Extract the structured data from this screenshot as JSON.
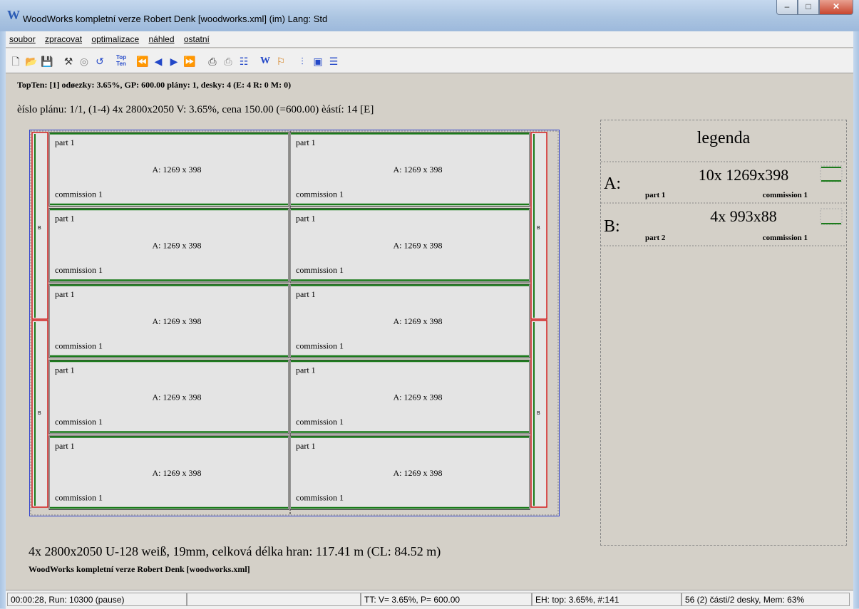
{
  "window": {
    "title": "WoodWorks kompletní verze Robert Denk [woodworks.xml] (im) Lang: Std",
    "icon": "W"
  },
  "menu": [
    "soubor",
    "zpracovat",
    "optimalizace",
    "náhled",
    "ostatní"
  ],
  "info": {
    "line1": "TopTen: [1] odøezky:  3.65%, GP: 600.00 plány: 1, desky: 4 (E: 4 R: 0 M: 0)",
    "line2": "èíslo plánu: 1/1, (1-4) 4x 2800x2050 V:  3.65%, cena 150.00 (=600.00) èástí: 14    [E]"
  },
  "parts": {
    "name": "part 1",
    "size": "A: 1269 x 398",
    "commission": "commission 1",
    "rows": 5,
    "cols": 2
  },
  "strip_labels": [
    "B",
    "B"
  ],
  "legend": {
    "title": "legenda",
    "items": [
      {
        "key": "A:",
        "qty": "10x 1269x398",
        "part": "part 1",
        "commission": "commission 1"
      },
      {
        "key": "B:",
        "qty": "4x 993x88",
        "part": "part 2",
        "commission": "commission 1"
      }
    ]
  },
  "bottom": {
    "summary": "4x 2800x2050 U-128 weiß, 19mm, celková délka hran: 117.41 m (CL: 84.52 m)",
    "subtitle": "WoodWorks kompletní verze Robert Denk [woodworks.xml]"
  },
  "status": {
    "time": "00:00:28, Run: 10300 (pause)",
    "empty": "",
    "tt": "TT: V= 3.65%, P= 600.00",
    "eh": "EH: top: 3.65%,  #:141",
    "mem": "56 (2) části/2 desky, Mem: 63%"
  },
  "colors": {
    "edge": "#1a7a1a",
    "strip": "#d42020",
    "board_border": "#3344cc"
  }
}
